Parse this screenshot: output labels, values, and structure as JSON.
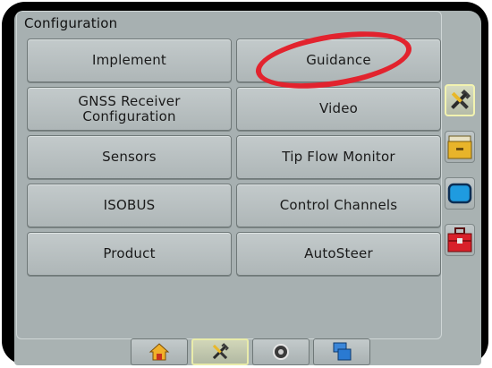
{
  "panel": {
    "title": "Configuration"
  },
  "buttons": [
    {
      "label": "Implement"
    },
    {
      "label": "Guidance"
    },
    {
      "label": "GNSS Receiver Configuration"
    },
    {
      "label": "Video"
    },
    {
      "label": "Sensors"
    },
    {
      "label": "Tip Flow Monitor"
    },
    {
      "label": "ISOBUS"
    },
    {
      "label": "Control Channels"
    },
    {
      "label": "Product"
    },
    {
      "label": "AutoSteer"
    }
  ],
  "sidebar": {
    "items": [
      {
        "icon": "tools-icon",
        "active": true
      },
      {
        "icon": "folder-icon",
        "active": false
      },
      {
        "icon": "display-icon",
        "active": false
      },
      {
        "icon": "toolbox-icon",
        "active": false
      }
    ]
  },
  "bottom_tabs": [
    {
      "icon": "home-icon",
      "active": false
    },
    {
      "icon": "tools-icon",
      "active": true
    },
    {
      "icon": "speaker-icon",
      "active": false
    },
    {
      "icon": "windows-icon",
      "active": false
    }
  ],
  "colors": {
    "highlight_circle": "#e2232e",
    "active_border": "#f2f3b0",
    "background": "#a9b2b2"
  }
}
